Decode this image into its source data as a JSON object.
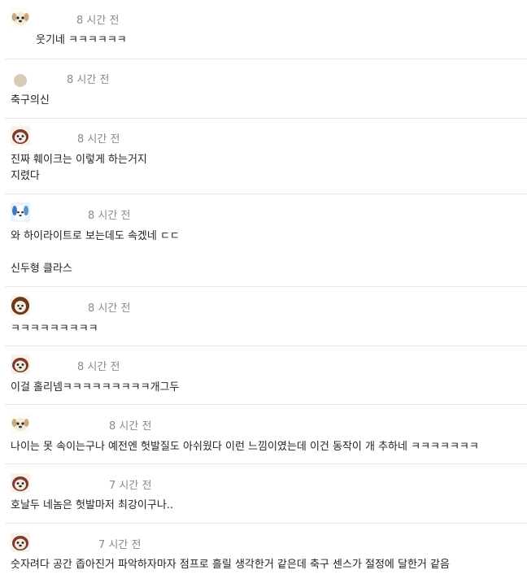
{
  "comments": [
    {
      "time": "8 시간 전",
      "lines": [
        "웃기네 ㅋㅋㅋㅋㅋㅋ"
      ],
      "avatar": "puppy-avatar"
    },
    {
      "time": "8 시간 전",
      "lines": [
        "축구의신"
      ],
      "avatar": "default-avatar"
    },
    {
      "time": "8 시간 전",
      "lines": [
        "진짜 훼이크는 이렇게 하는거지",
        "지렸다"
      ],
      "avatar": "dog-avatar"
    },
    {
      "time": "8 시간 전",
      "lines": [
        "와 하이라이트로 보는데도 속겠네 ㄷㄷ",
        "",
        "신두형 클라스"
      ],
      "avatar": "blue-dog-avatar"
    },
    {
      "time": "8 시간 전",
      "lines": [
        "ㅋㅋㅋㅋㅋㅋㅋㅋㅋ"
      ],
      "avatar": "lion-avatar"
    },
    {
      "time": "8 시간 전",
      "lines": [
        "이걸 홀리넴ㅋㅋㅋㅋㅋㅋㅋㅋㅋ개그두"
      ],
      "avatar": "dog-avatar"
    },
    {
      "time": "8 시간 전",
      "lines": [
        "나이는 못 속이는구나 예전엔 헛발질도 아쉬웠다 이런 느낌이였는데 이건 동작이 개 추하네 ㅋㅋㅋㅋㅋㅋㅋ"
      ],
      "avatar": "puppy-avatar"
    },
    {
      "time": "7 시간 전",
      "lines": [
        "호날두 네놈은 헛발마저 최강이구나.."
      ],
      "avatar": "dog-avatar"
    },
    {
      "time": "7 시간 전",
      "lines": [
        "숫자려다 공간 좁아진거 파악하자마자 점프로 흘릴 생각한거 같은데 축구 센스가 절정에 달한거 같음"
      ],
      "avatar": "dog-avatar"
    }
  ]
}
